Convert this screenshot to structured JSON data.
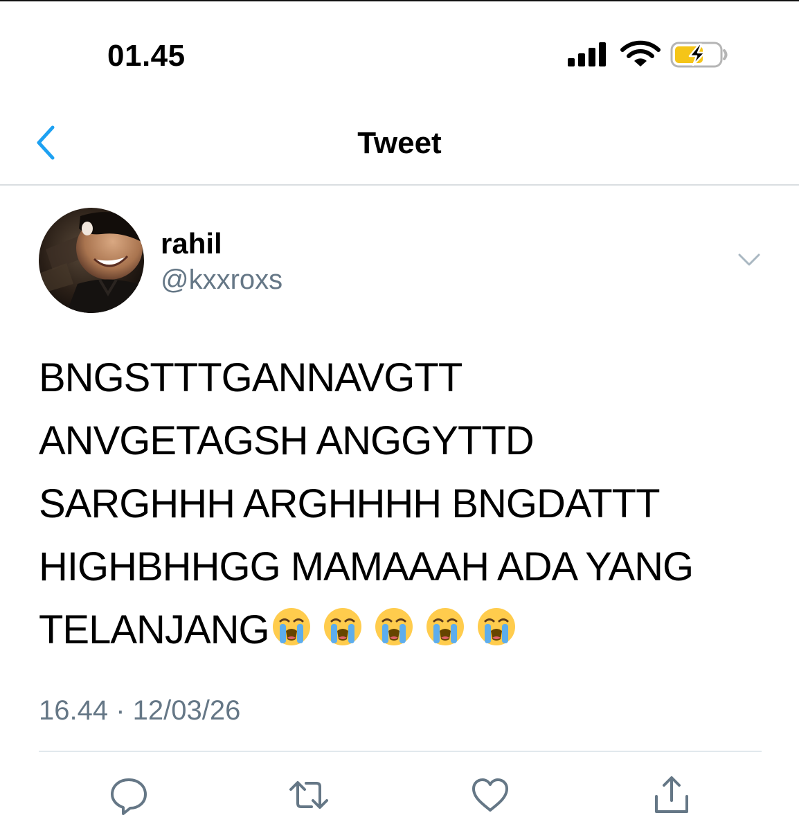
{
  "status_bar": {
    "time": "01.45",
    "icons": [
      "signal-icon",
      "wifi-icon",
      "battery-charging-icon"
    ],
    "battery_color": "#f5c518"
  },
  "nav": {
    "title": "Tweet",
    "back_icon": "chevron-left-icon",
    "accent_color": "#1da1f2"
  },
  "tweet": {
    "author": {
      "display_name": "rahil",
      "handle": "@kxxroxs"
    },
    "text": "BNGSTTTGANNAVGTT\nANVGETAGSH ANGGYTTD\nSARGHHH ARGHHHH BNGDATTT\nHIGHBHHGG MAMAAAH ADA YANG\nTELANJANG",
    "emojis": [
      "loudly-crying-face-icon",
      "loudly-crying-face-icon",
      "loudly-crying-face-icon",
      "loudly-crying-face-icon",
      "loudly-crying-face-icon"
    ],
    "timestamp": "16.44 · 12/03/26"
  },
  "actions": [
    "reply-icon",
    "retweet-icon",
    "like-icon",
    "share-icon"
  ],
  "colors": {
    "secondary_text": "#657786",
    "divider": "#e1e8ed"
  }
}
